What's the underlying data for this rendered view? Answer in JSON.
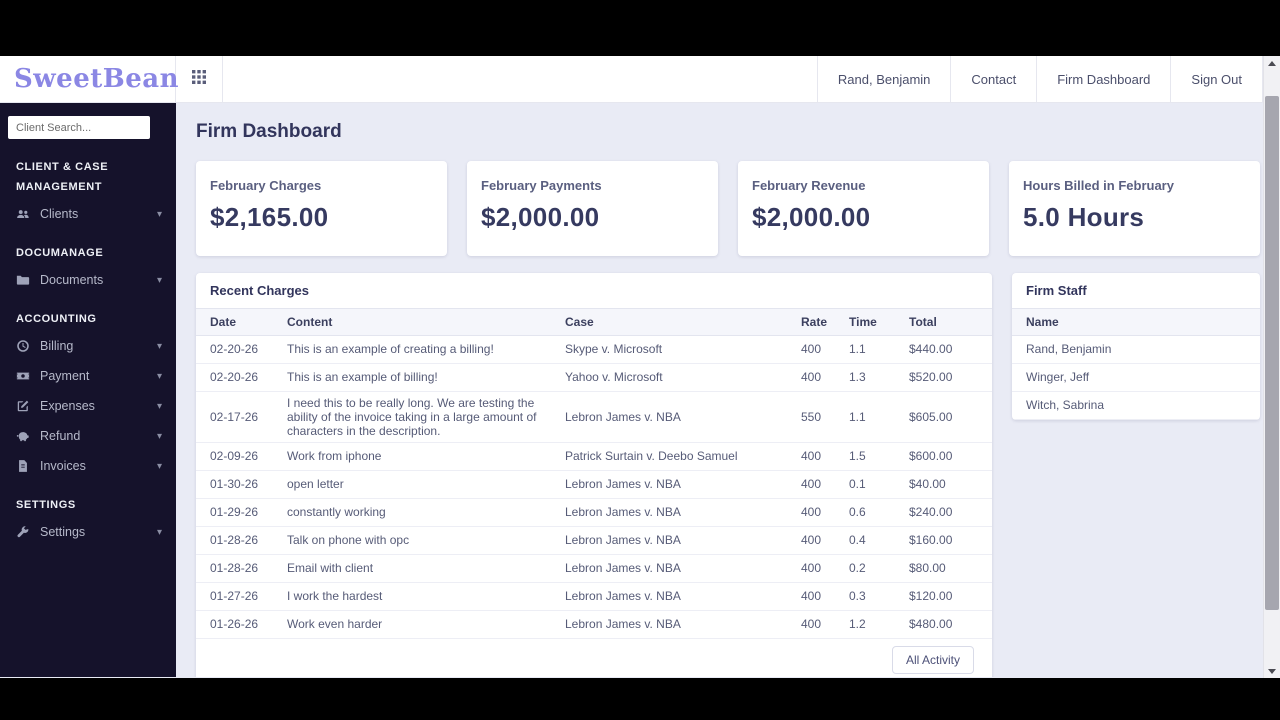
{
  "brand": {
    "logo": "SweetBean"
  },
  "colors": {
    "brand_purple": "#8b87e4",
    "sidebar_bg": "#15122b",
    "main_bg": "#e9ebf5",
    "heading_navy": "#32355c"
  },
  "header": {
    "nav": [
      {
        "label": "Rand, Benjamin"
      },
      {
        "label": "Contact"
      },
      {
        "label": "Firm Dashboard"
      },
      {
        "label": "Sign Out"
      }
    ]
  },
  "sidebar": {
    "search_placeholder": "Client Search...",
    "sections": [
      {
        "heading": "CLIENT & CASE MANAGEMENT",
        "items": [
          {
            "icon": "users-icon",
            "label": "Clients"
          }
        ]
      },
      {
        "heading": "DOCUMANAGE",
        "items": [
          {
            "icon": "folder-icon",
            "label": "Documents"
          }
        ]
      },
      {
        "heading": "ACCOUNTING",
        "items": [
          {
            "icon": "clock-icon",
            "label": "Billing"
          },
          {
            "icon": "money-icon",
            "label": "Payment"
          },
          {
            "icon": "pen-square-icon",
            "label": "Expenses"
          },
          {
            "icon": "piggy-bank-icon",
            "label": "Refund"
          },
          {
            "icon": "file-invoice-icon",
            "label": "Invoices"
          }
        ]
      },
      {
        "heading": "SETTINGS",
        "items": [
          {
            "icon": "wrench-icon",
            "label": "Settings"
          }
        ]
      }
    ]
  },
  "main": {
    "title": "Firm Dashboard",
    "stats": [
      {
        "label": "February Charges",
        "value": "$2,165.00"
      },
      {
        "label": "February Payments",
        "value": "$2,000.00"
      },
      {
        "label": "February Revenue",
        "value": "$2,000.00"
      },
      {
        "label": "Hours Billed in February",
        "value": "5.0 Hours"
      }
    ],
    "recent_charges": {
      "title": "Recent Charges",
      "columns": [
        "Date",
        "Content",
        "Case",
        "Rate",
        "Time",
        "Total"
      ],
      "rows": [
        {
          "date": "02-20-26",
          "content": "This is an example of creating a billing!",
          "case": "Skype v. Microsoft",
          "rate": "400",
          "time": "1.1",
          "total": "$440.00"
        },
        {
          "date": "02-20-26",
          "content": "This is an example of billing!",
          "case": "Yahoo v. Microsoft",
          "rate": "400",
          "time": "1.3",
          "total": "$520.00"
        },
        {
          "date": "02-17-26",
          "content": "I need this to be really long. We are testing the ability of the invoice taking in a large amount of characters in the description.",
          "case": "Lebron James v. NBA",
          "rate": "550",
          "time": "1.1",
          "total": "$605.00"
        },
        {
          "date": "02-09-26",
          "content": "Work from iphone",
          "case": "Patrick Surtain v. Deebo Samuel",
          "rate": "400",
          "time": "1.5",
          "total": "$600.00"
        },
        {
          "date": "01-30-26",
          "content": "open letter",
          "case": "Lebron James v. NBA",
          "rate": "400",
          "time": "0.1",
          "total": "$40.00"
        },
        {
          "date": "01-29-26",
          "content": "constantly working",
          "case": "Lebron James v. NBA",
          "rate": "400",
          "time": "0.6",
          "total": "$240.00"
        },
        {
          "date": "01-28-26",
          "content": "Talk on phone with opc",
          "case": "Lebron James v. NBA",
          "rate": "400",
          "time": "0.4",
          "total": "$160.00"
        },
        {
          "date": "01-28-26",
          "content": "Email with client",
          "case": "Lebron James v. NBA",
          "rate": "400",
          "time": "0.2",
          "total": "$80.00"
        },
        {
          "date": "01-27-26",
          "content": "I work the hardest",
          "case": "Lebron James v. NBA",
          "rate": "400",
          "time": "0.3",
          "total": "$120.00"
        },
        {
          "date": "01-26-26",
          "content": "Work even harder",
          "case": "Lebron James v. NBA",
          "rate": "400",
          "time": "1.2",
          "total": "$480.00"
        }
      ],
      "footer_button": "All Activity"
    },
    "firm_staff": {
      "title": "Firm Staff",
      "columns": [
        "Name"
      ],
      "rows": [
        {
          "name": "Rand, Benjamin"
        },
        {
          "name": "Winger, Jeff"
        },
        {
          "name": "Witch, Sabrina"
        }
      ]
    }
  }
}
